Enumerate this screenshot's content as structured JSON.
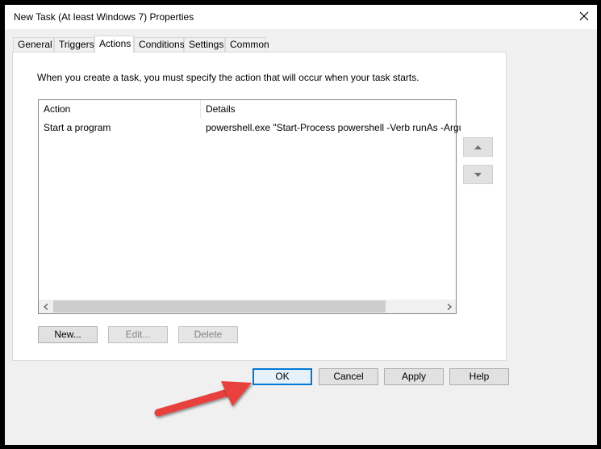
{
  "window": {
    "title": "New Task (At least Windows 7) Properties"
  },
  "tabs": [
    {
      "label": "General"
    },
    {
      "label": "Triggers"
    },
    {
      "label": "Actions"
    },
    {
      "label": "Conditions"
    },
    {
      "label": "Settings"
    },
    {
      "label": "Common"
    }
  ],
  "active_tab": "Actions",
  "actions_panel": {
    "instruction": "When you create a task, you must specify the action that will occur when your task starts.",
    "columns": {
      "action": "Action",
      "details": "Details"
    },
    "rows": [
      {
        "action": "Start a program",
        "details": "powershell.exe \"Start-Process powershell -Verb runAs -Argumen"
      }
    ],
    "buttons": {
      "new": "New...",
      "edit": "Edit...",
      "delete": "Delete"
    }
  },
  "dialog_buttons": {
    "ok": "OK",
    "cancel": "Cancel",
    "apply": "Apply",
    "help": "Help"
  },
  "colors": {
    "accent": "#0078d7",
    "annotation_arrow": "#e8413c"
  }
}
